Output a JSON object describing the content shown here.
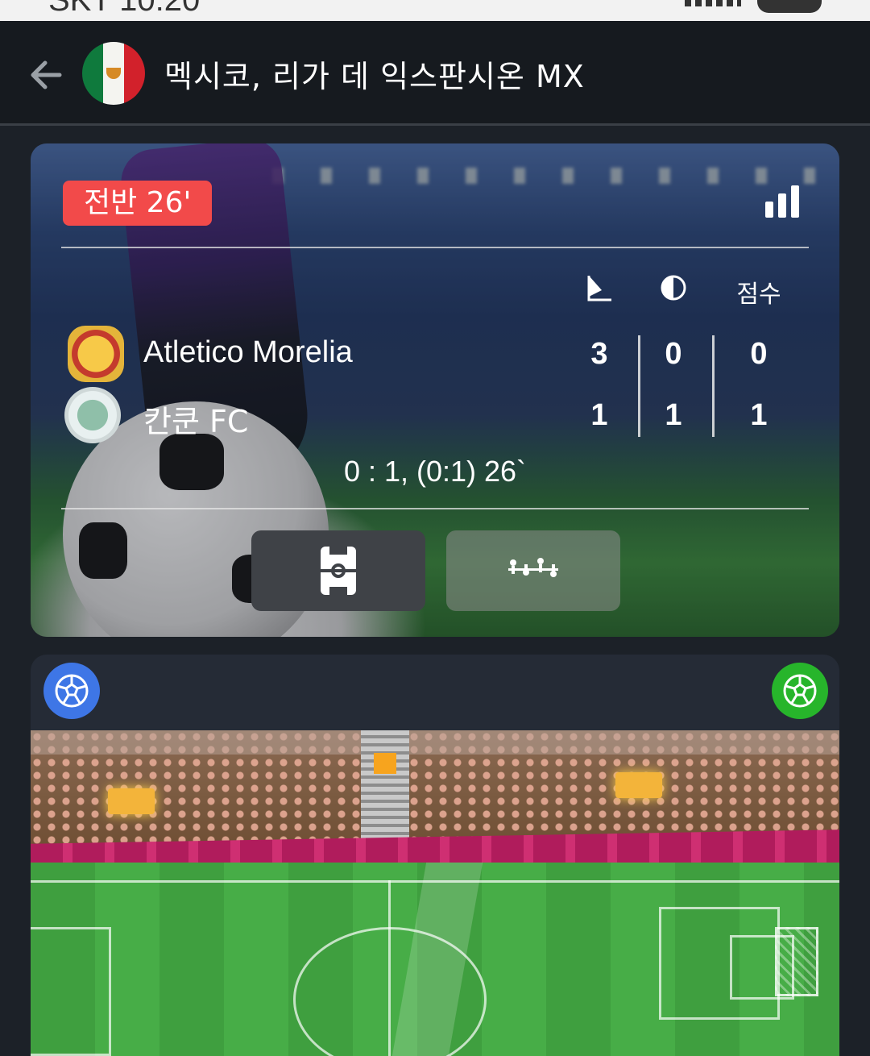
{
  "header": {
    "title": "멕시코, 리가 데 익스판시온 MX",
    "flag": "mexico-flag"
  },
  "match": {
    "status_label": "전반  26'",
    "columns": {
      "corners_icon": "corner-flag-icon",
      "half_icon": "half-time-icon",
      "score_label": "점수"
    },
    "teams": [
      {
        "name": "Atletico Morelia",
        "corners": "3",
        "half": "0",
        "score": "0",
        "logo": "atletico-morelia-logo"
      },
      {
        "name": "칸쿤 FC",
        "corners": "1",
        "half": "1",
        "score": "1",
        "logo": "cancun-fc-logo"
      }
    ],
    "last_event": "0 : 1, (0:1) 26`",
    "tabs": [
      {
        "name": "pitch-view-icon",
        "active": true
      },
      {
        "name": "lineup-icon",
        "active": false
      }
    ]
  },
  "field": {
    "home_icon": "soccer-ball-icon",
    "away_icon": "soccer-ball-icon",
    "colors": {
      "home": "#3e76e6",
      "away": "#27b52b",
      "live": "#f24a4a"
    }
  }
}
